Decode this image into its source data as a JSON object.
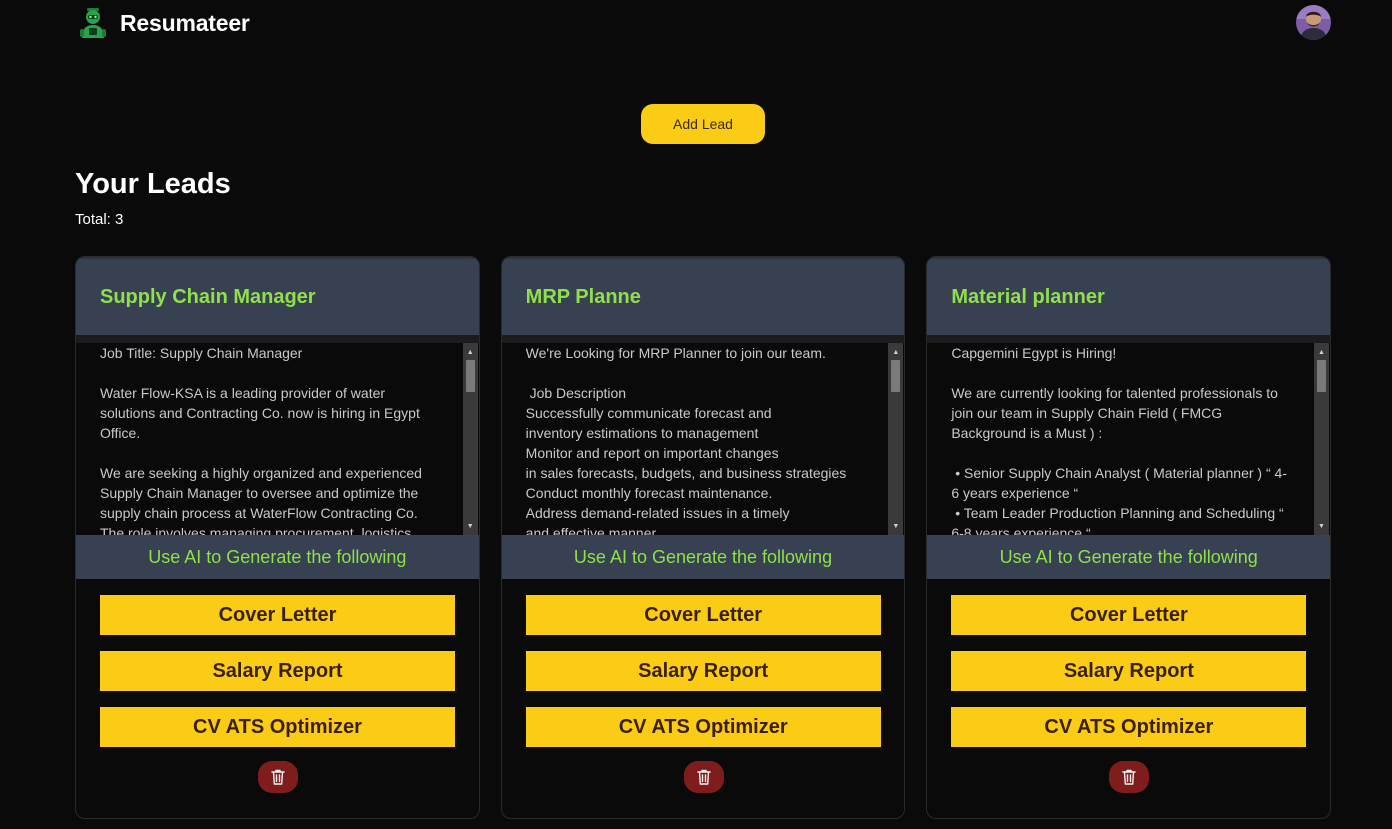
{
  "app": {
    "name": "Resumateer"
  },
  "header": {
    "add_lead_label": "Add Lead"
  },
  "leads_section": {
    "title": "Your Leads",
    "total_label": "Total:",
    "total_count": "3"
  },
  "cards": [
    {
      "title": "Supply Chain Manager",
      "description": "Job Title: Supply Chain Manager\n\nWater Flow-KSA is a leading provider of water solutions and Contracting Co. now is hiring in Egypt Office.\n\nWe are seeking a highly organized and experienced Supply Chain Manager to oversee and optimize the supply chain process at WaterFlow Contracting Co. The role involves managing procurement, logistics,",
      "ai_label": "Use AI to Generate the following",
      "buttons": {
        "cover_letter": "Cover Letter",
        "salary_report": "Salary Report",
        "cv_ats": "CV ATS Optimizer"
      }
    },
    {
      "title": "MRP Planne",
      "description": "We're Looking for MRP Planner to join our team.\n\n Job Description\nSuccessfully communicate forecast and\ninventory estimations to management\nMonitor and report on important changes\nin sales forecasts, budgets, and business strategies\nConduct monthly forecast maintenance.\nAddress demand-related issues in a timely\nand effective manner",
      "ai_label": "Use AI to Generate the following",
      "buttons": {
        "cover_letter": "Cover Letter",
        "salary_report": "Salary Report",
        "cv_ats": "CV ATS Optimizer"
      }
    },
    {
      "title": "Material planner",
      "description": "Capgemini Egypt is Hiring!\n\nWe are currently looking for talented professionals to join our team in Supply Chain Field ( FMCG Background is a Must ) :\n\n • Senior Supply Chain Analyst ( Material planner ) “ 4-6 years experience “\n • Team Leader Production Planning and Scheduling “ 6-8 years experience “",
      "ai_label": "Use AI to Generate the following",
      "buttons": {
        "cover_letter": "Cover Letter",
        "salary_report": "Salary Report",
        "cv_ats": "CV ATS Optimizer"
      }
    }
  ],
  "icons": {
    "logo": "robot-mascot-icon",
    "avatar": "user-avatar",
    "delete": "trash-icon",
    "scroll_up": "triangle-up-icon",
    "scroll_down": "triangle-down-icon"
  },
  "colors": {
    "background": "#0a0a0a",
    "accent_yellow": "#facc15",
    "title_green": "#8fe04a",
    "card_header": "#374151",
    "delete_red": "#7f1d1d"
  }
}
